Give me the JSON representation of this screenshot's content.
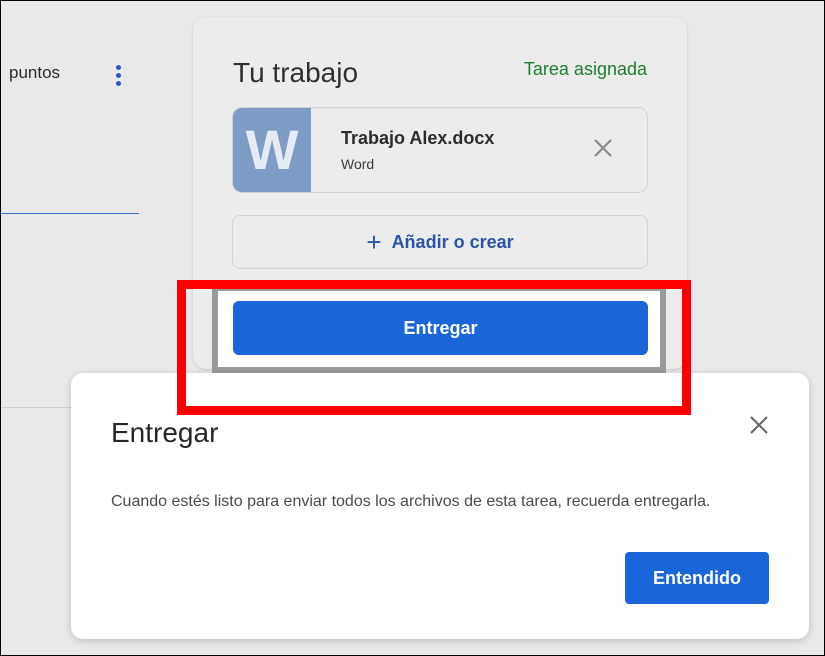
{
  "background": {
    "points_label": "puntos"
  },
  "work_card": {
    "title": "Tu trabajo",
    "status": "Tarea asignada",
    "attachment": {
      "thumb_letter": "W",
      "name": "Trabajo Alex.docx",
      "type": "Word"
    },
    "add_label": "Añadir o crear",
    "add_plus": "+",
    "submit_label": "Entregar"
  },
  "dialog": {
    "title": "Entregar",
    "body": "Cuando estés listo para enviar todos los archivos de esta tarea, recuerda entregarla.",
    "ok_label": "Entendido"
  },
  "colors": {
    "accent_blue": "#1a66d8",
    "status_green": "#1e7d2e",
    "highlight_red": "#ff0000",
    "word_thumb": "#7f9cc6"
  }
}
